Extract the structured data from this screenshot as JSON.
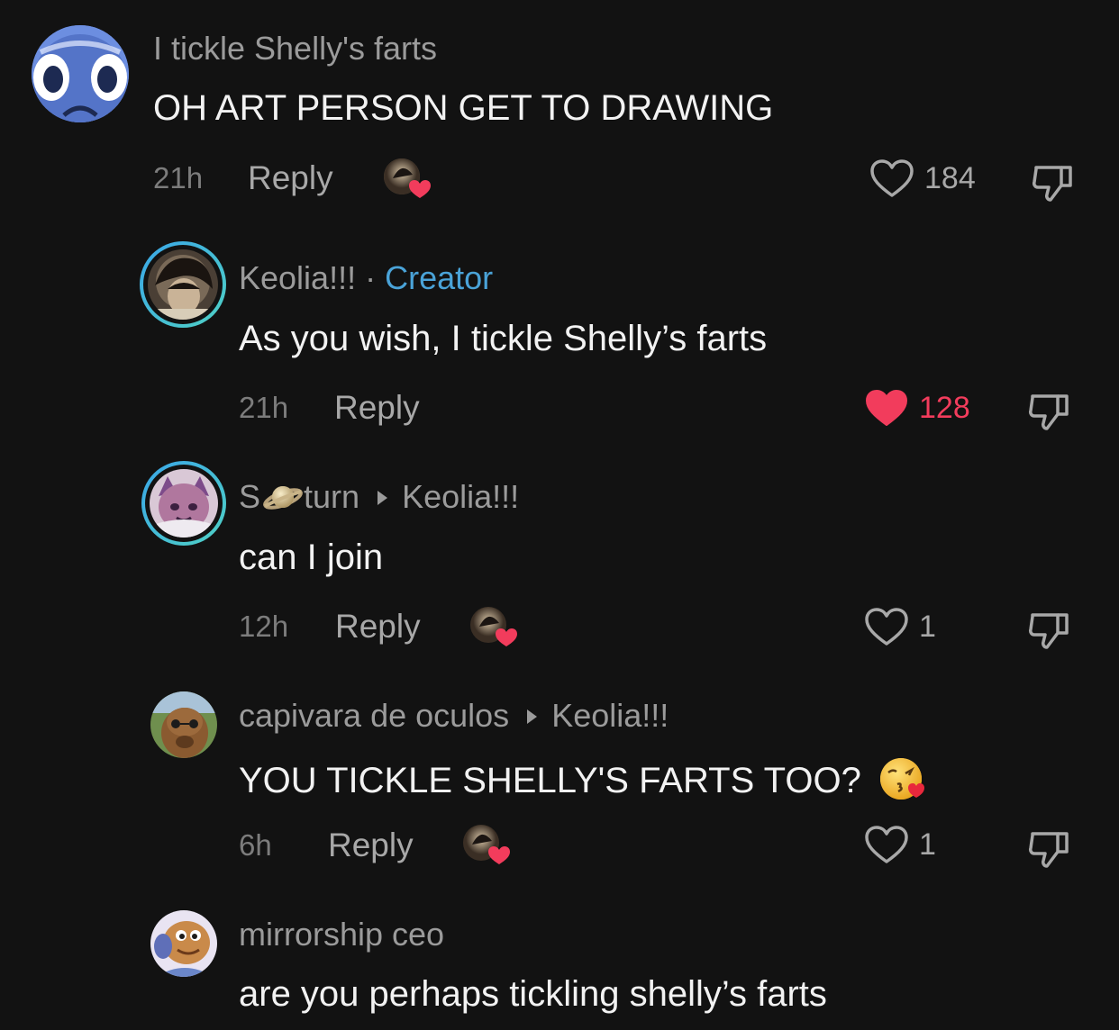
{
  "comments": [
    {
      "username": "I tickle Shelly's farts",
      "text": "OH ART PERSON GET TO DRAWING",
      "time": "21h",
      "reply_label": "Reply",
      "likes": "184",
      "liked": false,
      "creator_liked": true
    },
    {
      "username": "Keolia!!!",
      "separator": "·",
      "badge": "Creator",
      "text": "As you wish, I tickle Shelly’s farts",
      "time": "21h",
      "reply_label": "Reply",
      "likes": "128",
      "liked": true,
      "creator_liked": false
    },
    {
      "username_before": "S",
      "username_emoji": "saturn-emoji",
      "username_after": "turn",
      "reply_to": "Keolia!!!",
      "text": "can I join",
      "time": "12h",
      "reply_label": "Reply",
      "likes": "1",
      "liked": false,
      "creator_liked": true
    },
    {
      "username": "capivara de oculos",
      "reply_to": "Keolia!!!",
      "text": "YOU TICKLE SHELLY'S FARTS TOO?",
      "text_emoji": "face-blowing-kiss-emoji",
      "time": "6h",
      "reply_label": "Reply",
      "likes": "1",
      "liked": false,
      "creator_liked": true
    },
    {
      "username": "mirrorship ceo",
      "text": "are you perhaps tickling shelly’s farts"
    }
  ],
  "colors": {
    "background": "#121212",
    "creator_badge": "#4aa3d8",
    "liked_heart": "#f23c5c",
    "story_ring_start": "#3aa6e8",
    "story_ring_end": "#4fd1c5"
  }
}
